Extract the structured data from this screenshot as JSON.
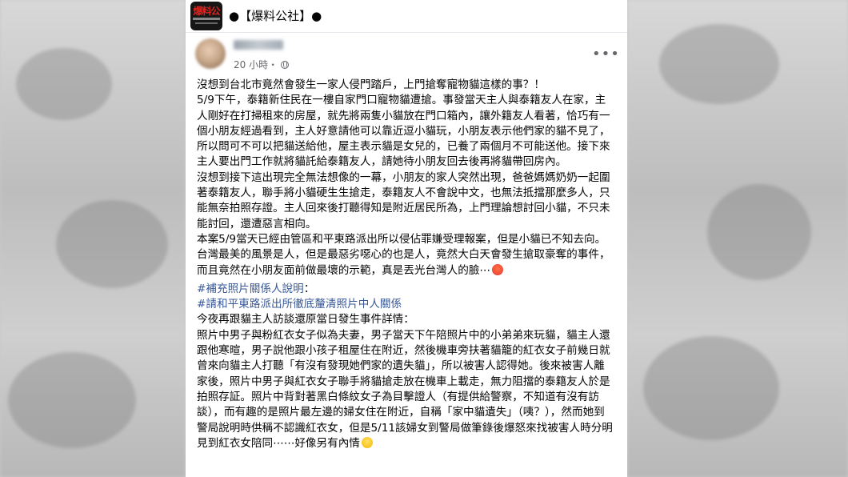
{
  "group": {
    "logo_text": "爆料公",
    "name": "●【爆料公社】●"
  },
  "post": {
    "time": "20 小時・",
    "privacy_icon": "globe-icon",
    "more_icon": "more-options-icon",
    "paragraphs": [
      "沒想到台北市竟然會發生一家人侵門踏戶，上門搶奪寵物貓這樣的事？！",
      "5/9下午，泰籍新住民在一樓自家門口寵物貓遭搶。事發當天主人與泰籍友人在家，主人剛好在打掃租來的房屋，就先將兩隻小貓放在門口箱內，讓外籍友人看著，恰巧有一個小朋友經過看到，主人好意請他可以靠近逗小貓玩，小朋友表示他們家的貓不見了，所以問可不可以把貓送給他，屋主表示貓是女兒的，已養了兩個月不可能送他。接下來主人要出門工作就將貓託給泰籍友人，請她待小朋友回去後再將貓帶回房內。",
      "沒想到接下這出現完全無法想像的一幕，小朋友的家人突然出現，爸爸媽媽奶奶一起圍著泰籍友人，聯手將小貓硬生生搶走，泰籍友人不會說中文，也無法抵擋那麼多人，只能無奈拍照存證。主人回來後打聽得知是附近居民所為，上門理論想討回小貓，不只未能討回，還遭惡言相向。",
      "本案5/9當天已經由管區和平東路派出所以侵佔罪嫌受理報案，但是小貓已不知去向。",
      "台灣最美的風景是人，但是最惡劣噁心的也是人，竟然大白天會發生搶取豪奪的事件，而且竟然在小朋友面前做最壞的示範，真是丟光台灣人的臉⋯"
    ],
    "hashtag1": "#補充照片關係人說明",
    "hashtag1_suffix": "：",
    "hashtag2": "#請和平東路派出所徹底釐清照片中人關係",
    "intro": "今夜再跟貓主人訪談還原當日發生事件詳情：",
    "detail": "照片中男子與粉紅衣女子似為夫妻，男子當天下午陪照片中的小弟弟來玩貓，貓主人還跟他寒暄，男子說他跟小孩子租屋住在附近，然後機車旁扶著貓籠的紅衣女子前幾日就曾來向貓主人打聽「有沒有發現她們家的遺失貓」，所以被害人認得她。後來被害人離家後，照片中男子與紅衣女子聯手將貓搶走放在機車上載走，無力阻擋的泰籍友人於是拍照存証。照片中背對著黑白條紋女子為目擊證人（有提供給警察，不知道有沒有訪談），而有趣的是照片最左邊的婦女住在附近，自稱「家中貓遺失」（咦？），然而她到警局說明時供稱不認識紅衣女，但是5/11該婦女到警局做筆錄後爆怒來找被害人時分明見到紅衣女陪同⋯⋯好像另有內情"
  },
  "colors": {
    "link": "#385898",
    "text": "#050505",
    "meta": "#65676b",
    "logo_red": "#e0231e"
  }
}
